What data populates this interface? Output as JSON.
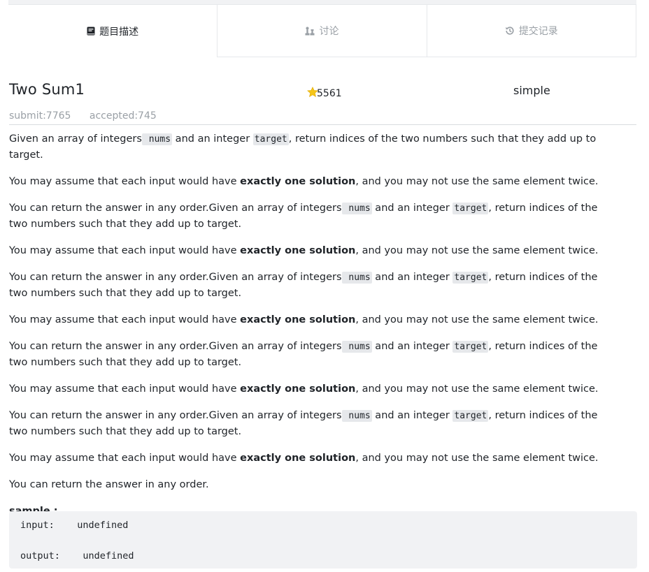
{
  "tabs": [
    {
      "label": "题目描述",
      "icon": "book-icon",
      "active": true
    },
    {
      "label": "讨论",
      "icon": "chess-icon",
      "active": false
    },
    {
      "label": "提交记录",
      "icon": "history-icon",
      "active": false
    }
  ],
  "problem": {
    "title": "Two Sum1",
    "stars": "5561",
    "difficulty": "simple",
    "submit": "submit:7765",
    "accepted": "accepted:745"
  },
  "content": {
    "given_a": "Given an array of integers",
    "nums": " nums",
    "and_integer": " and an integer ",
    "target": "target",
    "return_a": ", return indices of the two numbers such that they add up to target.",
    "assume_a": "You may assume that each input would have ",
    "exactly": "exactly one solution",
    "assume_b": ", and you may not use the same element twice.",
    "can_return_given": "You can return the answer in any order.Given an array of integers",
    "can_return": "You can return the answer in any order.",
    "sample_label": "sample :"
  },
  "sample": {
    "input_line": "input:    undefined",
    "output_line": "output:    undefined"
  },
  "colors": {
    "star": "#f5c518",
    "inline_code_bg": "#e6e8eb",
    "code_block_bg": "#f1f2f4"
  }
}
